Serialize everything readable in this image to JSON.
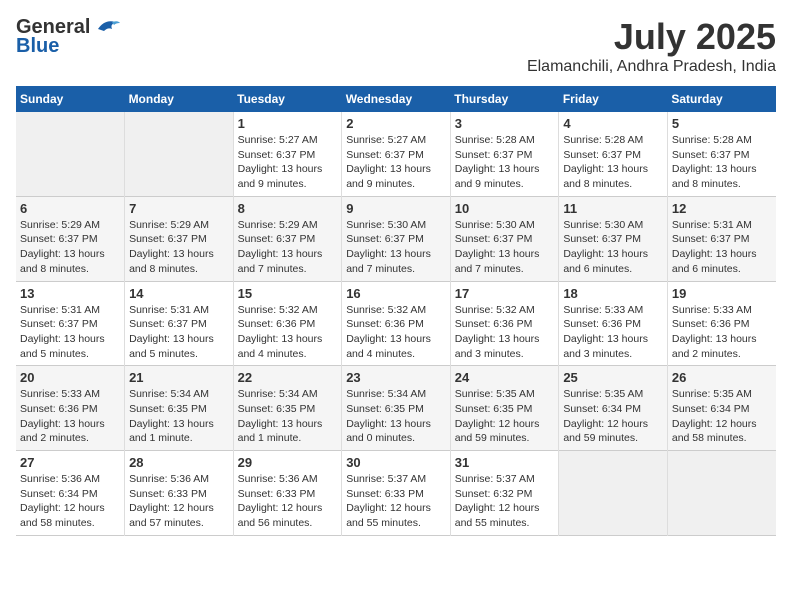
{
  "header": {
    "logo_general": "General",
    "logo_blue": "Blue",
    "title": "July 2025",
    "subtitle": "Elamanchili, Andhra Pradesh, India"
  },
  "weekdays": [
    "Sunday",
    "Monday",
    "Tuesday",
    "Wednesday",
    "Thursday",
    "Friday",
    "Saturday"
  ],
  "weeks": [
    [
      {
        "day": "",
        "info": ""
      },
      {
        "day": "",
        "info": ""
      },
      {
        "day": "1",
        "info": "Sunrise: 5:27 AM\nSunset: 6:37 PM\nDaylight: 13 hours and 9 minutes."
      },
      {
        "day": "2",
        "info": "Sunrise: 5:27 AM\nSunset: 6:37 PM\nDaylight: 13 hours and 9 minutes."
      },
      {
        "day": "3",
        "info": "Sunrise: 5:28 AM\nSunset: 6:37 PM\nDaylight: 13 hours and 9 minutes."
      },
      {
        "day": "4",
        "info": "Sunrise: 5:28 AM\nSunset: 6:37 PM\nDaylight: 13 hours and 8 minutes."
      },
      {
        "day": "5",
        "info": "Sunrise: 5:28 AM\nSunset: 6:37 PM\nDaylight: 13 hours and 8 minutes."
      }
    ],
    [
      {
        "day": "6",
        "info": "Sunrise: 5:29 AM\nSunset: 6:37 PM\nDaylight: 13 hours and 8 minutes."
      },
      {
        "day": "7",
        "info": "Sunrise: 5:29 AM\nSunset: 6:37 PM\nDaylight: 13 hours and 8 minutes."
      },
      {
        "day": "8",
        "info": "Sunrise: 5:29 AM\nSunset: 6:37 PM\nDaylight: 13 hours and 7 minutes."
      },
      {
        "day": "9",
        "info": "Sunrise: 5:30 AM\nSunset: 6:37 PM\nDaylight: 13 hours and 7 minutes."
      },
      {
        "day": "10",
        "info": "Sunrise: 5:30 AM\nSunset: 6:37 PM\nDaylight: 13 hours and 7 minutes."
      },
      {
        "day": "11",
        "info": "Sunrise: 5:30 AM\nSunset: 6:37 PM\nDaylight: 13 hours and 6 minutes."
      },
      {
        "day": "12",
        "info": "Sunrise: 5:31 AM\nSunset: 6:37 PM\nDaylight: 13 hours and 6 minutes."
      }
    ],
    [
      {
        "day": "13",
        "info": "Sunrise: 5:31 AM\nSunset: 6:37 PM\nDaylight: 13 hours and 5 minutes."
      },
      {
        "day": "14",
        "info": "Sunrise: 5:31 AM\nSunset: 6:37 PM\nDaylight: 13 hours and 5 minutes."
      },
      {
        "day": "15",
        "info": "Sunrise: 5:32 AM\nSunset: 6:36 PM\nDaylight: 13 hours and 4 minutes."
      },
      {
        "day": "16",
        "info": "Sunrise: 5:32 AM\nSunset: 6:36 PM\nDaylight: 13 hours and 4 minutes."
      },
      {
        "day": "17",
        "info": "Sunrise: 5:32 AM\nSunset: 6:36 PM\nDaylight: 13 hours and 3 minutes."
      },
      {
        "day": "18",
        "info": "Sunrise: 5:33 AM\nSunset: 6:36 PM\nDaylight: 13 hours and 3 minutes."
      },
      {
        "day": "19",
        "info": "Sunrise: 5:33 AM\nSunset: 6:36 PM\nDaylight: 13 hours and 2 minutes."
      }
    ],
    [
      {
        "day": "20",
        "info": "Sunrise: 5:33 AM\nSunset: 6:36 PM\nDaylight: 13 hours and 2 minutes."
      },
      {
        "day": "21",
        "info": "Sunrise: 5:34 AM\nSunset: 6:35 PM\nDaylight: 13 hours and 1 minute."
      },
      {
        "day": "22",
        "info": "Sunrise: 5:34 AM\nSunset: 6:35 PM\nDaylight: 13 hours and 1 minute."
      },
      {
        "day": "23",
        "info": "Sunrise: 5:34 AM\nSunset: 6:35 PM\nDaylight: 13 hours and 0 minutes."
      },
      {
        "day": "24",
        "info": "Sunrise: 5:35 AM\nSunset: 6:35 PM\nDaylight: 12 hours and 59 minutes."
      },
      {
        "day": "25",
        "info": "Sunrise: 5:35 AM\nSunset: 6:34 PM\nDaylight: 12 hours and 59 minutes."
      },
      {
        "day": "26",
        "info": "Sunrise: 5:35 AM\nSunset: 6:34 PM\nDaylight: 12 hours and 58 minutes."
      }
    ],
    [
      {
        "day": "27",
        "info": "Sunrise: 5:36 AM\nSunset: 6:34 PM\nDaylight: 12 hours and 58 minutes."
      },
      {
        "day": "28",
        "info": "Sunrise: 5:36 AM\nSunset: 6:33 PM\nDaylight: 12 hours and 57 minutes."
      },
      {
        "day": "29",
        "info": "Sunrise: 5:36 AM\nSunset: 6:33 PM\nDaylight: 12 hours and 56 minutes."
      },
      {
        "day": "30",
        "info": "Sunrise: 5:37 AM\nSunset: 6:33 PM\nDaylight: 12 hours and 55 minutes."
      },
      {
        "day": "31",
        "info": "Sunrise: 5:37 AM\nSunset: 6:32 PM\nDaylight: 12 hours and 55 minutes."
      },
      {
        "day": "",
        "info": ""
      },
      {
        "day": "",
        "info": ""
      }
    ]
  ]
}
